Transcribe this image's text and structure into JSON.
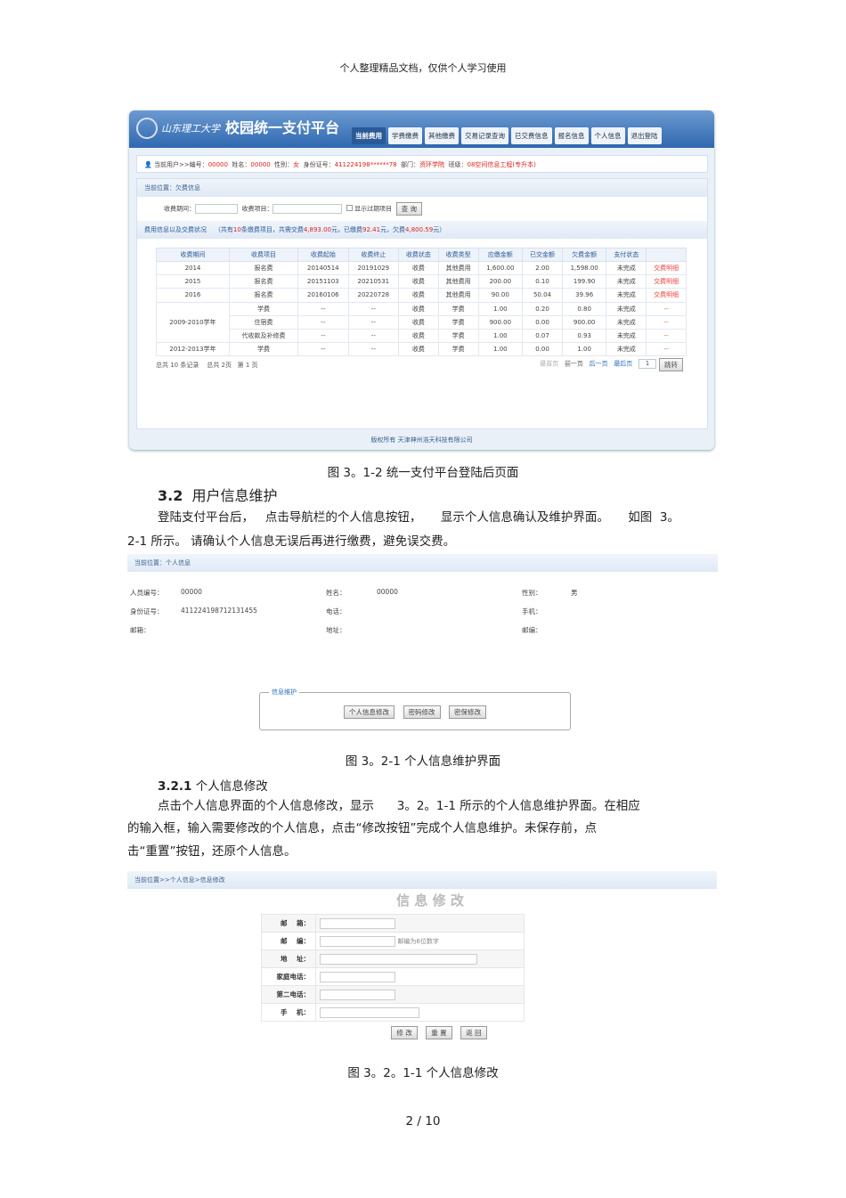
{
  "doc_header": "个人整理精品文档，仅供个人学习使用",
  "shot1": {
    "school": "山东理工大学",
    "title": "校园统一支付平台",
    "nav": [
      "当前费用",
      "学费缴费",
      "其他缴费",
      "交易记录查询",
      "已交费信息",
      "报名信息",
      "个人信息",
      "退出登陆"
    ],
    "user": {
      "prefix": "当前用户>>编号：",
      "id": "00000",
      "name_label": "姓名：",
      "name": "00000",
      "sex_label": "性别：",
      "sex": "女",
      "idcard_label": "身份证号：",
      "idcard": "411224198******78",
      "dept_label": "部门：",
      "dept": "资环学院",
      "class_label": "班级：",
      "class": "08空间信息工程(专升本)"
    },
    "location": "当前位置：欠费信息",
    "filter": {
      "period_label": "收费期间：",
      "item_label": "收费项目：",
      "show_expired": "显示过期项目",
      "query": "查 询"
    },
    "summary": {
      "label": "费用信息以及交费状况",
      "pre": "（共有",
      "count": "10",
      "mid1": "条缴费项目，共需交费",
      "total": "4,893.00",
      "mid2": "元，已缴费",
      "paid": "92.41",
      "mid3": "元，欠费",
      "owed": "4,800.59",
      "end": "元）"
    },
    "columns": [
      "收费期间",
      "收费项目",
      "收费起始",
      "收费终止",
      "收费状态",
      "收费类型",
      "应缴金额",
      "已交金额",
      "欠费金额",
      "支付状态",
      ""
    ],
    "rows": [
      [
        "2014",
        "报名费",
        "20140514",
        "20191029",
        "收费",
        "其他费用",
        "1,600.00",
        "2.00",
        "1,598.00",
        "未完成",
        "交费明细"
      ],
      [
        "2015",
        "报名费",
        "20151103",
        "20210531",
        "收费",
        "其他费用",
        "200.00",
        "0.10",
        "199.90",
        "未完成",
        "交费明细"
      ],
      [
        "2016",
        "报名费",
        "20160106",
        "20220728",
        "收费",
        "其他费用",
        "90.00",
        "50.04",
        "39.96",
        "未完成",
        "交费明细"
      ],
      [
        "2009-2010学年",
        "学费",
        "--",
        "--",
        "收费",
        "学费",
        "1.00",
        "0.20",
        "0.80",
        "未完成",
        "--"
      ],
      [
        "",
        "住宿费",
        "--",
        "--",
        "收费",
        "学费",
        "900.00",
        "0.00",
        "900.00",
        "未完成",
        "--"
      ],
      [
        "",
        "代收款及补修费",
        "--",
        "--",
        "收费",
        "学费",
        "1.00",
        "0.07",
        "0.93",
        "未完成",
        "--"
      ],
      [
        "2012-2013学年",
        "学费",
        "--",
        "--",
        "收费",
        "学费",
        "1.00",
        "0.00",
        "1.00",
        "未完成",
        "--"
      ]
    ],
    "pager": {
      "records": "总共 10 条记录",
      "pages": "总共 2页",
      "current": "第 1 页",
      "first": "最首页",
      "prev": "前一页",
      "next": "后一页",
      "last": "最后页",
      "page_input": "1",
      "go": "跳转"
    },
    "copyright": "版权所有 天津神州浩天科技有限公司"
  },
  "caption1": "图  3。1-2  统一支付平台登陆后页面",
  "section_32": {
    "num": "3.2",
    "title": "用户信息维护"
  },
  "para_32_1": "登陆支付平台后，   点击导航栏的个人信息按钮，     显示个人信息确认及维护界面。     如图  3。",
  "para_32_2": "2-1 所示。 请确认个人信息无误后再进行缴费，避免误交费。",
  "shot2": {
    "location": "当前位置：个人信息",
    "fields": [
      {
        "label": "人员编号：",
        "value": "00000"
      },
      {
        "label": "姓名：",
        "value": "00000"
      },
      {
        "label": "性别：",
        "value": "男"
      },
      {
        "label": "身份证号：",
        "value": "411224198712131455"
      },
      {
        "label": "电话：",
        "value": ""
      },
      {
        "label": "手机：",
        "value": ""
      },
      {
        "label": "邮箱：",
        "value": ""
      },
      {
        "label": "地址：",
        "value": ""
      },
      {
        "label": "邮编：",
        "value": ""
      }
    ],
    "legend": "信息维护",
    "buttons": [
      "个人信息修改",
      "密码修改",
      "密保修改"
    ]
  },
  "caption2": "图  3。2-1  个人信息维护界面",
  "section_321": {
    "num": "3.2.1",
    "title": "个人信息修改"
  },
  "para_321_1": "点击个人信息界面的个人信息修改，显示      3。2。1-1 所示的个人信息维护界面。在相应",
  "para_321_2": "的输入框，输入需要修改的个人信息，点击“修改按钮”完成个人信息维护。未保存前，点",
  "para_321_3": "击“重置”按钮，还原个人信息。",
  "shot3": {
    "location": "当前位置>>个人信息>信息修改",
    "title": "信 息 修 改",
    "rows": [
      {
        "label": "邮    箱：",
        "hint": ""
      },
      {
        "label": "邮    编：",
        "hint": "邮编为6位数字"
      },
      {
        "label": "地    址：",
        "hint": ""
      },
      {
        "label": "家庭电话：",
        "hint": ""
      },
      {
        "label": "第二电话：",
        "hint": ""
      },
      {
        "label": "手    机：",
        "hint": ""
      }
    ],
    "buttons": [
      "修 改",
      "重 置",
      "返 回"
    ]
  },
  "caption3": "图  3。2。1-1  个人信息修改",
  "page_number": "2 / 10"
}
